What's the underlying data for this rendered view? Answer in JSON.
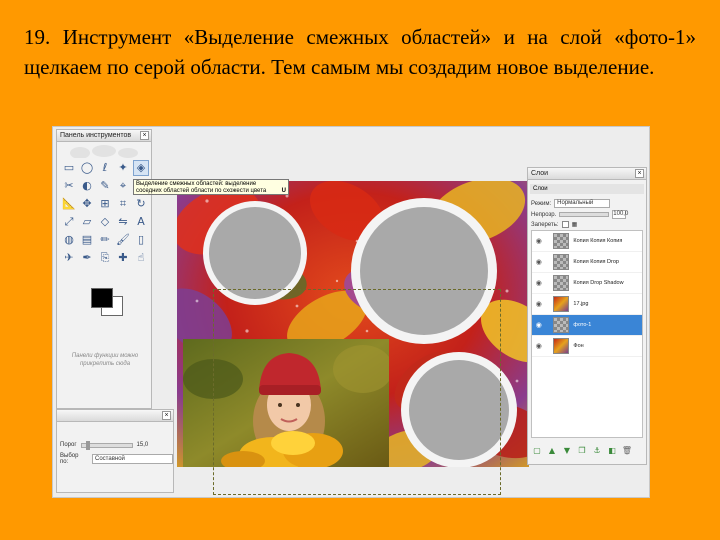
{
  "caption": "19. Инструмент «Выделение смежных областей» и на слой «фото-1» щелкаем по серой области. Тем самым мы создадим новое выделение.",
  "toolbox": {
    "title": "Панель инструментов",
    "hint": "Панели функции можно прикрепить сюда",
    "tools": [
      "rect-select-icon",
      "ellipse-select-icon",
      "lasso-icon",
      "fuzzy-select-icon",
      "color-select-icon",
      "scissors-icon",
      "foreground-select-icon",
      "paths-icon",
      "color-picker-icon",
      "zoom-icon",
      "measure-icon",
      "move-icon",
      "align-icon",
      "crop-icon",
      "rotate-icon",
      "scale-icon",
      "shear-icon",
      "perspective-icon",
      "flip-icon",
      "text-icon",
      "bucket-icon",
      "blend-icon",
      "pencil-icon",
      "brush-icon",
      "eraser-icon",
      "airbrush-icon",
      "ink-icon",
      "clone-icon",
      "heal-icon",
      "smudge-icon"
    ],
    "active_tool_index": 4,
    "fg_color": "#000000",
    "bg_color": "#FFFFFF"
  },
  "tooltip": {
    "line1": "Выделение смежных областей: выделение",
    "line2": "соседних областей области по схожести цвета",
    "shortcut": "U"
  },
  "options": {
    "threshold_label": "Порог",
    "threshold_value": "15,0",
    "select_by_label": "Выбор по:",
    "select_by_value": "Составной"
  },
  "layers": {
    "title": "Слои",
    "tab": "Слои",
    "mode_label": "Режим:",
    "mode_value": "Нормальный",
    "opacity_label": "Непрозр.",
    "opacity_value": "100,0",
    "lock_label": "Запереть:",
    "items": [
      {
        "name": "Копия Копия Копия",
        "thumb": "transparent",
        "selected": false
      },
      {
        "name": "Копия Копия Drop",
        "thumb": "transparent",
        "selected": false
      },
      {
        "name": "Копия Drop Shadow",
        "thumb": "transparent",
        "selected": false
      },
      {
        "name": "17.jpg",
        "thumb": "photo",
        "selected": false
      },
      {
        "name": "фото-1",
        "thumb": "transparent",
        "selected": true
      },
      {
        "name": "Фон",
        "thumb": "photo",
        "selected": false
      }
    ]
  }
}
